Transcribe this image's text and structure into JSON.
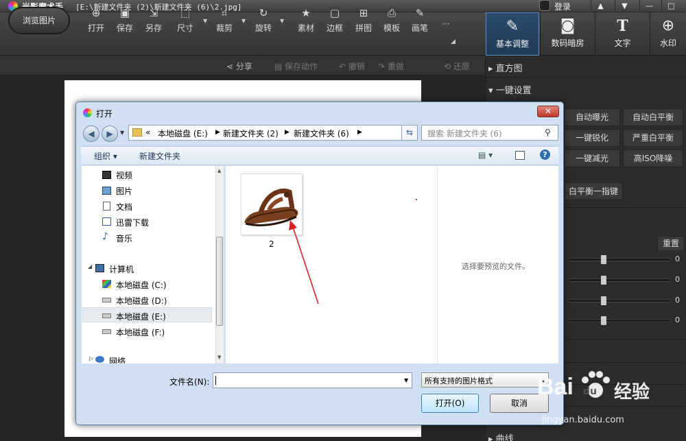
{
  "app": {
    "title": "光影魔术手",
    "file_path": "[E:\\新建文件夹 (2)\\新建文件夹 (6)\\2.jpg]",
    "login": "登录"
  },
  "window_buttons": [
    "▲",
    "▼",
    "—",
    "□"
  ],
  "toolbar": {
    "browse": "浏览图片",
    "tools": [
      {
        "label": "打开",
        "icon": "open-icon"
      },
      {
        "label": "保存",
        "icon": "save-icon"
      },
      {
        "label": "另存",
        "icon": "save-as-icon"
      },
      {
        "label": "尺寸",
        "icon": "resize-icon"
      },
      {
        "label": "裁剪",
        "icon": "crop-icon"
      },
      {
        "label": "旋转",
        "icon": "rotate-icon"
      },
      {
        "label": "素材",
        "icon": "material-icon"
      },
      {
        "label": "边框",
        "icon": "frame-icon"
      },
      {
        "label": "拼图",
        "icon": "collage-icon"
      },
      {
        "label": "模板",
        "icon": "template-icon"
      },
      {
        "label": "画笔",
        "icon": "brush-icon"
      }
    ],
    "more": "···"
  },
  "right_tabs": [
    {
      "label": "基本调整",
      "icon": "edit-icon"
    },
    {
      "label": "数码暗房",
      "icon": "camera-icon"
    },
    {
      "label": "文字",
      "icon": "text-icon"
    },
    {
      "label": "水印",
      "icon": "watermark-icon"
    }
  ],
  "secondary": {
    "share": "分享",
    "save_action": "保存动作",
    "undo": "撤销",
    "redo": "重做",
    "restore": "还原"
  },
  "panel": {
    "histogram": "直方图",
    "one_click": "一键设置",
    "buttons": [
      "自动曝光",
      "自动白平衡",
      "一键锐化",
      "严重白平衡",
      "一键减光",
      "高ISO降噪"
    ],
    "wb_button": "白平衡一指键",
    "reset": "重置",
    "slider_values": [
      "0",
      "0",
      "0",
      "0"
    ],
    "curve": "曲线"
  },
  "dialog": {
    "title": "打开",
    "close": "✕",
    "breadcrumb": [
      "«",
      "本地磁盘 (E:)",
      "新建文件夹 (2)",
      "新建文件夹 (6)"
    ],
    "search_placeholder": "搜索 新建文件夹 (6)",
    "organize": "组织 ▾",
    "new_folder": "新建文件夹",
    "nav_items": [
      {
        "label": "视频",
        "icon": "video-icon"
      },
      {
        "label": "图片",
        "icon": "pictures-icon"
      },
      {
        "label": "文档",
        "icon": "documents-icon"
      },
      {
        "label": "迅雷下载",
        "icon": "download-icon"
      },
      {
        "label": "音乐",
        "icon": "music-icon"
      },
      {
        "label": "计算机",
        "icon": "computer-icon"
      },
      {
        "label": "本地磁盘 (C:)",
        "icon": "drive-icon"
      },
      {
        "label": "本地磁盘 (D:)",
        "icon": "drive-icon"
      },
      {
        "label": "本地磁盘 (E:)",
        "icon": "drive-icon"
      },
      {
        "label": "本地磁盘 (F:)",
        "icon": "drive-icon"
      },
      {
        "label": "网络",
        "icon": "network-icon"
      }
    ],
    "file_label": "2",
    "preview_text": "选择要预览的文件。",
    "filename_label": "文件名(N):",
    "filename_value": "",
    "filetype": "所有支持的图片格式",
    "open": "打开(O)",
    "cancel": "取消"
  },
  "watermark": {
    "brand": "Bai",
    "brand2": "du",
    "cn": "经验",
    "url": "jingyan.baidu.com"
  }
}
